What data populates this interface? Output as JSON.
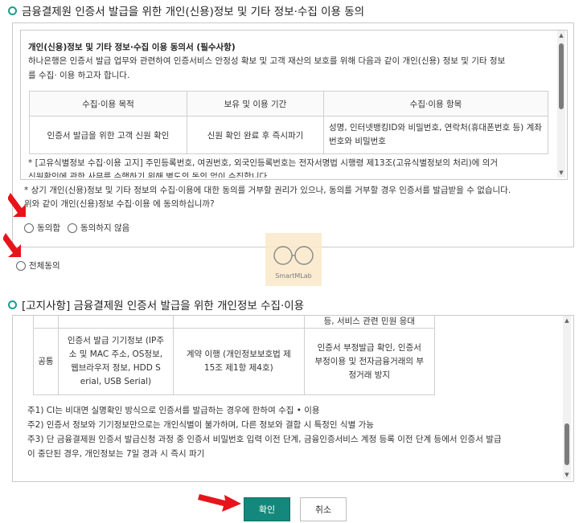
{
  "section1": {
    "title": "금융결제원 인증서 발급을 위한 개인(신용)정보 및 기타 정보·수집 이용 동의",
    "consent_heading": "개인(신용)정보 및 기타 정보·수집 이용 동의서 (필수사항)",
    "intro_line1": "하나은행은 인증서 발급 업무와 관련하여 인증서비스 안정성 확보 및 고객 재산의 보호를 위해 다음과 같이 개인(신용) 정보 및 기타 정보",
    "intro_line2": "를 수집· 이용 하고자 합니다.",
    "table": {
      "headers": [
        "수집·이용 목적",
        "보유 및 이용 기간",
        "수집·이용 항목"
      ],
      "row": [
        "인증서 발급을 위한 고객 신원 확인",
        "신원 확인 완료 후 즉시파기",
        "성명, 인터넷뱅킹ID와 비밀번호, 연락처(휴대폰번호 등) 계좌",
        "번호와 비밀번호"
      ]
    },
    "note_line1": "* [고유식별정보 수집·이용 고지] 주민등록번호, 여권번호, 외국인등록번호는 전자서명법 시행령 제13조(고유식별정보의 처리)에 의거",
    "note_line2": "신원확인에 관한 사무를 수행하기 위해 별도의 동의 없이 수집합니다.",
    "question_line1": "* 상기 개인(신용)정보 및 기타 정보의 수집·이용에 대한 동의를 거부할 권리가 있으나, 동의를 거부할 경우 인증서를 발급받을 수 없습니다.",
    "question_line2": "위와 같이 개인(신용)정보 수집·이용 에 동의하십니까?",
    "agree_label": "동의함",
    "disagree_label": "동의하지 않음"
  },
  "agree_all_label": "전체동의",
  "watermark": "SmartMLab",
  "section2": {
    "title": "[고지사항] 금융결제원 인증서 발급을 위한 개인정보 수집·이용",
    "top_cut_text": "등, 서비스 관련 민원 응대",
    "row_label": "공통",
    "row_col1": "인증서 발급 기기정보 (IP주소 및 MAC 주소, OS정보, 웹브라우저 정보, HDD S erial, USB Serial)",
    "row_col2": "계약 이행 (개인정보보호법 제15조 제1항 제4호)",
    "row_col3": "인증서 부정발급 확인, 인증서 부정이용 및 전자금융거래의 부정거래 방지",
    "note1": "주1) CI는 비대면 실명확인 방식으로 인증서를 발급하는 경우에 한하여 수집 • 이용",
    "note2": "주2) 인증서 정보와 기기정보만으로는 개인식별이 불가하며, 다른 정보와 결합 시 특정인 식별 가능",
    "note3_line1": "주3) 단 금융결제원 인증서 발급신청 과정 중 인증서 비밀번호 입력 이전 단계, 금융인증서비스 계정 등록 이전 단계 등에서 인증서 발급",
    "note3_line2": "이 중단된 경우, 개인정보는 7일 경과 시 즉시 파기"
  },
  "buttons": {
    "confirm": "확인",
    "cancel": "취소"
  },
  "colors": {
    "accent": "#14887c",
    "arrow": "#e8141b"
  }
}
